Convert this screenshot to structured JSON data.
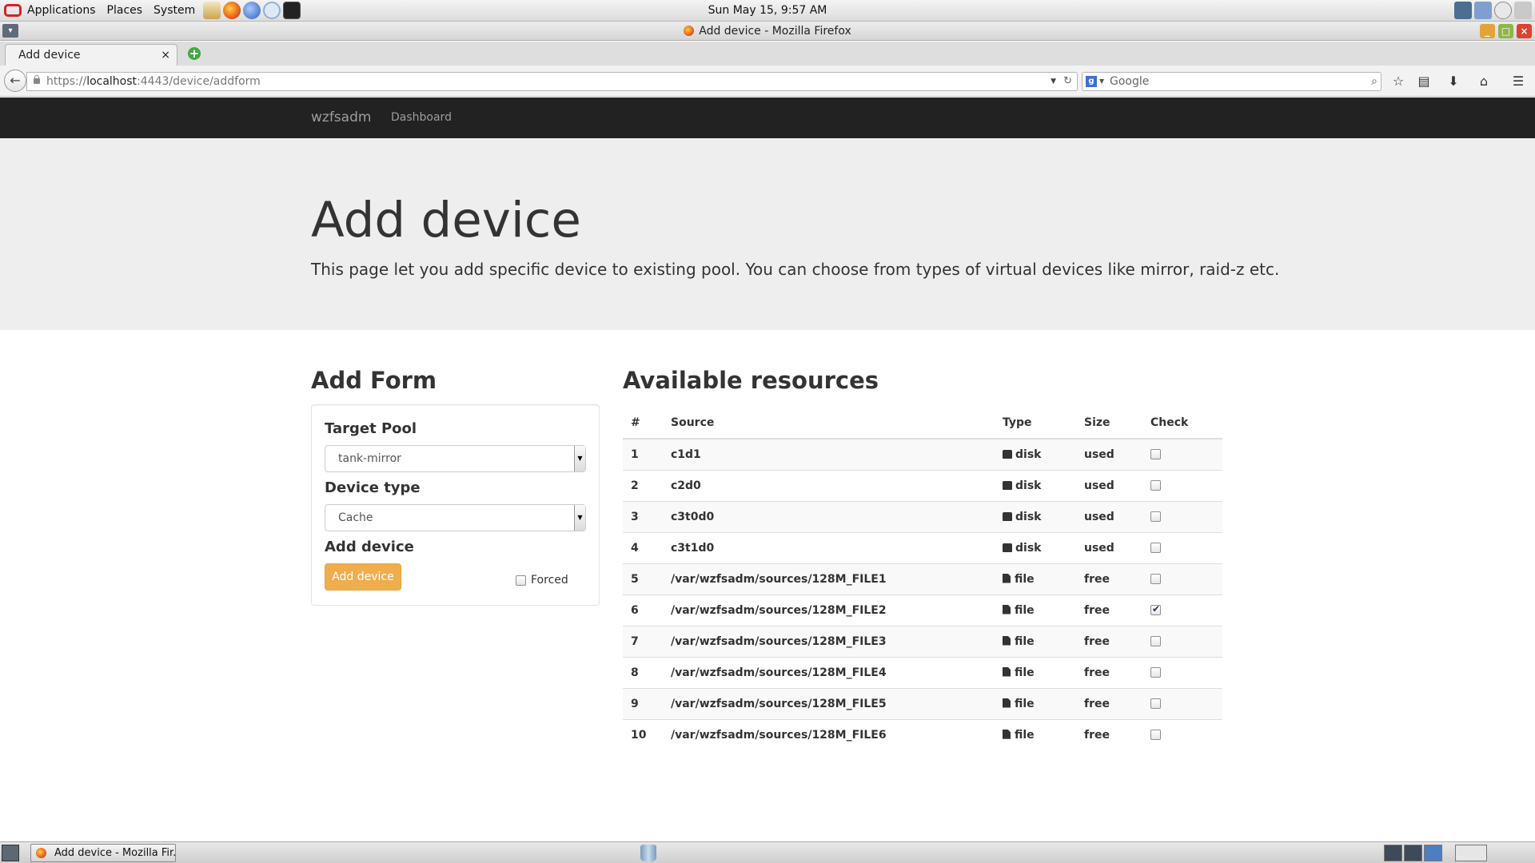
{
  "top_panel": {
    "menus": [
      "Applications",
      "Places",
      "System"
    ],
    "clock": "Sun May 15,  9:57 AM"
  },
  "window": {
    "title": "Add device - Mozilla Firefox"
  },
  "browser": {
    "tab_label": "Add device",
    "tab_close": "×",
    "new_tab": "+",
    "url_prefix": "https://",
    "url_host": "localhost",
    "url_rest": ":4443/device/addform",
    "search_placeholder": "Google",
    "search_engine_letter": "g"
  },
  "site": {
    "brand": "wzfsadm",
    "nav": [
      "Dashboard"
    ]
  },
  "jumbotron": {
    "title": "Add device",
    "lead": "This page let you add specific device to existing pool. You can choose from types of virtual devices like mirror, raid-z etc."
  },
  "add_form": {
    "heading": "Add Form",
    "target_pool_label": "Target Pool",
    "target_pool_value": "tank-mirror",
    "device_type_label": "Device type",
    "device_type_value": "Cache",
    "add_device_label": "Add device",
    "add_button": "Add device",
    "forced_label": "Forced",
    "forced_checked": false
  },
  "resources": {
    "heading": "Available resources",
    "columns": [
      "#",
      "Source",
      "Type",
      "Size",
      "Check"
    ],
    "rows": [
      {
        "num": "1",
        "source": "c1d1",
        "type": "disk",
        "type_icon": "hdd-icon",
        "size": "used",
        "checked": false
      },
      {
        "num": "2",
        "source": "c2d0",
        "type": "disk",
        "type_icon": "hdd-icon",
        "size": "used",
        "checked": false
      },
      {
        "num": "3",
        "source": "c3t0d0",
        "type": "disk",
        "type_icon": "hdd-icon",
        "size": "used",
        "checked": false
      },
      {
        "num": "4",
        "source": "c3t1d0",
        "type": "disk",
        "type_icon": "hdd-icon",
        "size": "used",
        "checked": false
      },
      {
        "num": "5",
        "source": "/var/wzfsadm/sources/128M_FILE1",
        "type": "file",
        "type_icon": "file-icon",
        "size": "free",
        "checked": false
      },
      {
        "num": "6",
        "source": "/var/wzfsadm/sources/128M_FILE2",
        "type": "file",
        "type_icon": "file-icon",
        "size": "free",
        "checked": true
      },
      {
        "num": "7",
        "source": "/var/wzfsadm/sources/128M_FILE3",
        "type": "file",
        "type_icon": "file-icon",
        "size": "free",
        "checked": false
      },
      {
        "num": "8",
        "source": "/var/wzfsadm/sources/128M_FILE4",
        "type": "file",
        "type_icon": "file-icon",
        "size": "free",
        "checked": false
      },
      {
        "num": "9",
        "source": "/var/wzfsadm/sources/128M_FILE5",
        "type": "file",
        "type_icon": "file-icon",
        "size": "free",
        "checked": false
      },
      {
        "num": "10",
        "source": "/var/wzfsadm/sources/128M_FILE6",
        "type": "file",
        "type_icon": "file-icon",
        "size": "free",
        "checked": false
      }
    ]
  },
  "taskbar": {
    "task_label": "Add device - Mozilla Fir..."
  },
  "colors": {
    "navbar_bg": "#222222",
    "jumbotron_bg": "#eeeeee",
    "button_warning": "#f0ad4e"
  }
}
